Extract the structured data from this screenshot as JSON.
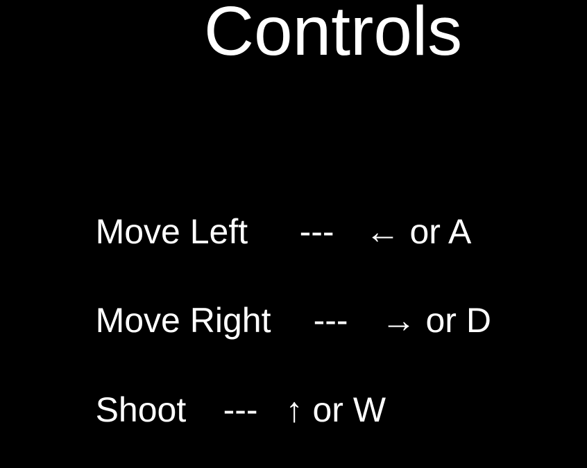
{
  "screen": {
    "title": "Controls",
    "background": "#000000",
    "text_color": "#ffffff"
  },
  "controls": [
    {
      "action": "Move Left",
      "separator": "---",
      "keys": "← or A"
    },
    {
      "action": "Move Right",
      "separator": "---",
      "keys": "→ or D"
    },
    {
      "action": "Shoot",
      "separator": "---",
      "keys": "↑ or W"
    }
  ]
}
